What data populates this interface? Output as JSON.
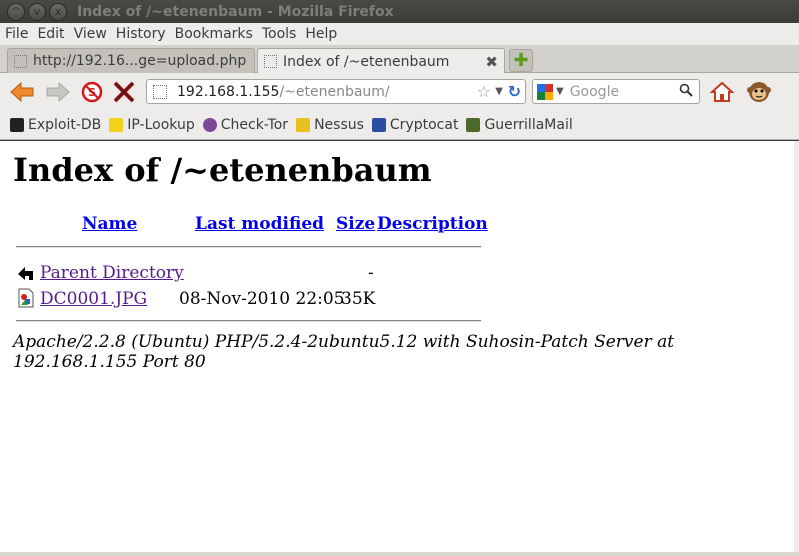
{
  "window": {
    "title": "Index of /~etenenbaum - Mozilla Firefox",
    "controls": [
      "^",
      "v",
      "x"
    ]
  },
  "menubar": {
    "items": [
      "File",
      "Edit",
      "View",
      "History",
      "Bookmarks",
      "Tools",
      "Help"
    ]
  },
  "tabs": [
    {
      "label": "http://192.16...ge=upload.php",
      "active": false
    },
    {
      "label": "Index of /~etenenbaum",
      "active": true,
      "close": "✖"
    }
  ],
  "newtab_label": "✚",
  "urlbar": {
    "host": "192.168.1.155",
    "path": "/~etenenbaum/"
  },
  "searchbar": {
    "placeholder": "Google"
  },
  "bookmarks": [
    {
      "label": "Exploit-DB",
      "icon": "exploitdb-icon",
      "color": "#222222"
    },
    {
      "label": "IP-Lookup",
      "icon": "iplookup-icon",
      "color": "#f2d21b"
    },
    {
      "label": "Check-Tor",
      "icon": "tor-onion-icon",
      "color": "#7e4798"
    },
    {
      "label": "Nessus",
      "icon": "nessus-icon",
      "color": "#e8c120"
    },
    {
      "label": "Cryptocat",
      "icon": "cryptocat-icon",
      "color": "#2a4fa0"
    },
    {
      "label": "GuerrillaMail",
      "icon": "guerrillamail-icon",
      "color": "#4c6b2a"
    }
  ],
  "page": {
    "heading": "Index of /~etenenbaum",
    "columns": {
      "name": "Name",
      "modified": "Last modified",
      "size": "Size",
      "description": "Description"
    },
    "rows": [
      {
        "name": "Parent Directory",
        "modified": "",
        "size": "-",
        "icon": "back-arrow-icon"
      },
      {
        "name": "DC0001.JPG",
        "modified": "08-Nov-2010 22:05",
        "size": "35K",
        "icon": "image-file-icon"
      }
    ],
    "signature": "Apache/2.2.8 (Ubuntu) PHP/5.2.4-2ubuntu5.12 with Suhosin-Patch Server at 192.168.1.155 Port 80"
  }
}
